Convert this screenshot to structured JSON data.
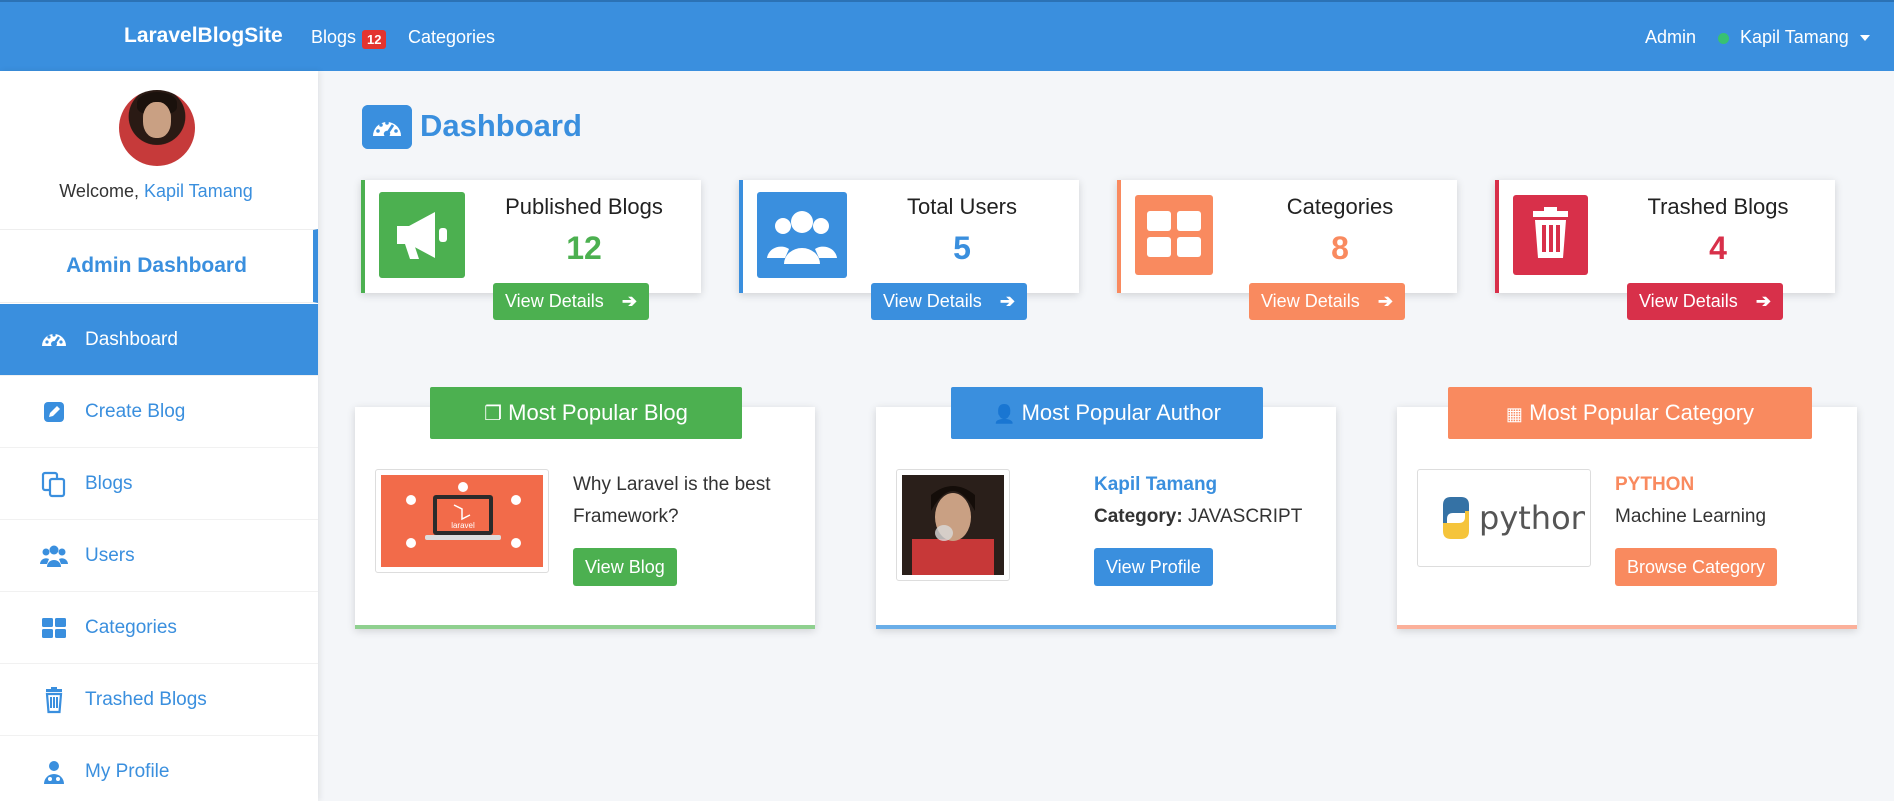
{
  "navbar": {
    "brand": "LaravelBlogSite",
    "blogs_label": "Blogs",
    "blogs_badge": "12",
    "categories_label": "Categories",
    "admin_label": "Admin",
    "user_name": "Kapil Tamang"
  },
  "sidebar": {
    "welcome_prefix": "Welcome,",
    "welcome_name": "Kapil Tamang",
    "header": "Admin Dashboard",
    "items": [
      {
        "label": "Dashboard",
        "icon": "tachometer-icon",
        "active": true
      },
      {
        "label": "Create Blog",
        "icon": "edit-icon"
      },
      {
        "label": "Blogs",
        "icon": "copy-icon"
      },
      {
        "label": "Users",
        "icon": "users-icon"
      },
      {
        "label": "Categories",
        "icon": "grid-icon"
      },
      {
        "label": "Trashed Blogs",
        "icon": "trash-icon"
      },
      {
        "label": "My Profile",
        "icon": "user-md-icon"
      }
    ]
  },
  "page": {
    "title": "Dashboard"
  },
  "stats": [
    {
      "label": "Published Blogs",
      "value": "12",
      "button": "View Details",
      "color": "#4cb050",
      "icon": "bullhorn-icon"
    },
    {
      "label": "Total Users",
      "value": "5",
      "button": "View Details",
      "color": "#3a8fde",
      "icon": "users-icon"
    },
    {
      "label": "Categories",
      "value": "8",
      "button": "View Details",
      "color": "#f98a5f",
      "icon": "grid-icon"
    },
    {
      "label": "Trashed Blogs",
      "value": "4",
      "button": "View Details",
      "color": "#d8304a",
      "icon": "trash-icon"
    }
  ],
  "popular": {
    "blog": {
      "header": "Most Popular Blog",
      "title": "Why Laravel is the best Framework?",
      "button": "View Blog",
      "color": "#4cb050",
      "thumb_text": "laravel"
    },
    "author": {
      "header": "Most Popular Author",
      "name": "Kapil Tamang",
      "category_label": "Category:",
      "category": "JAVASCRIPT",
      "button": "View Profile",
      "color": "#3a8fde"
    },
    "category": {
      "header": "Most Popular Category",
      "name": "PYTHON",
      "subtitle": "Machine Learning",
      "button": "Browse Category",
      "color": "#f98a5f",
      "logo_text": "python"
    }
  }
}
